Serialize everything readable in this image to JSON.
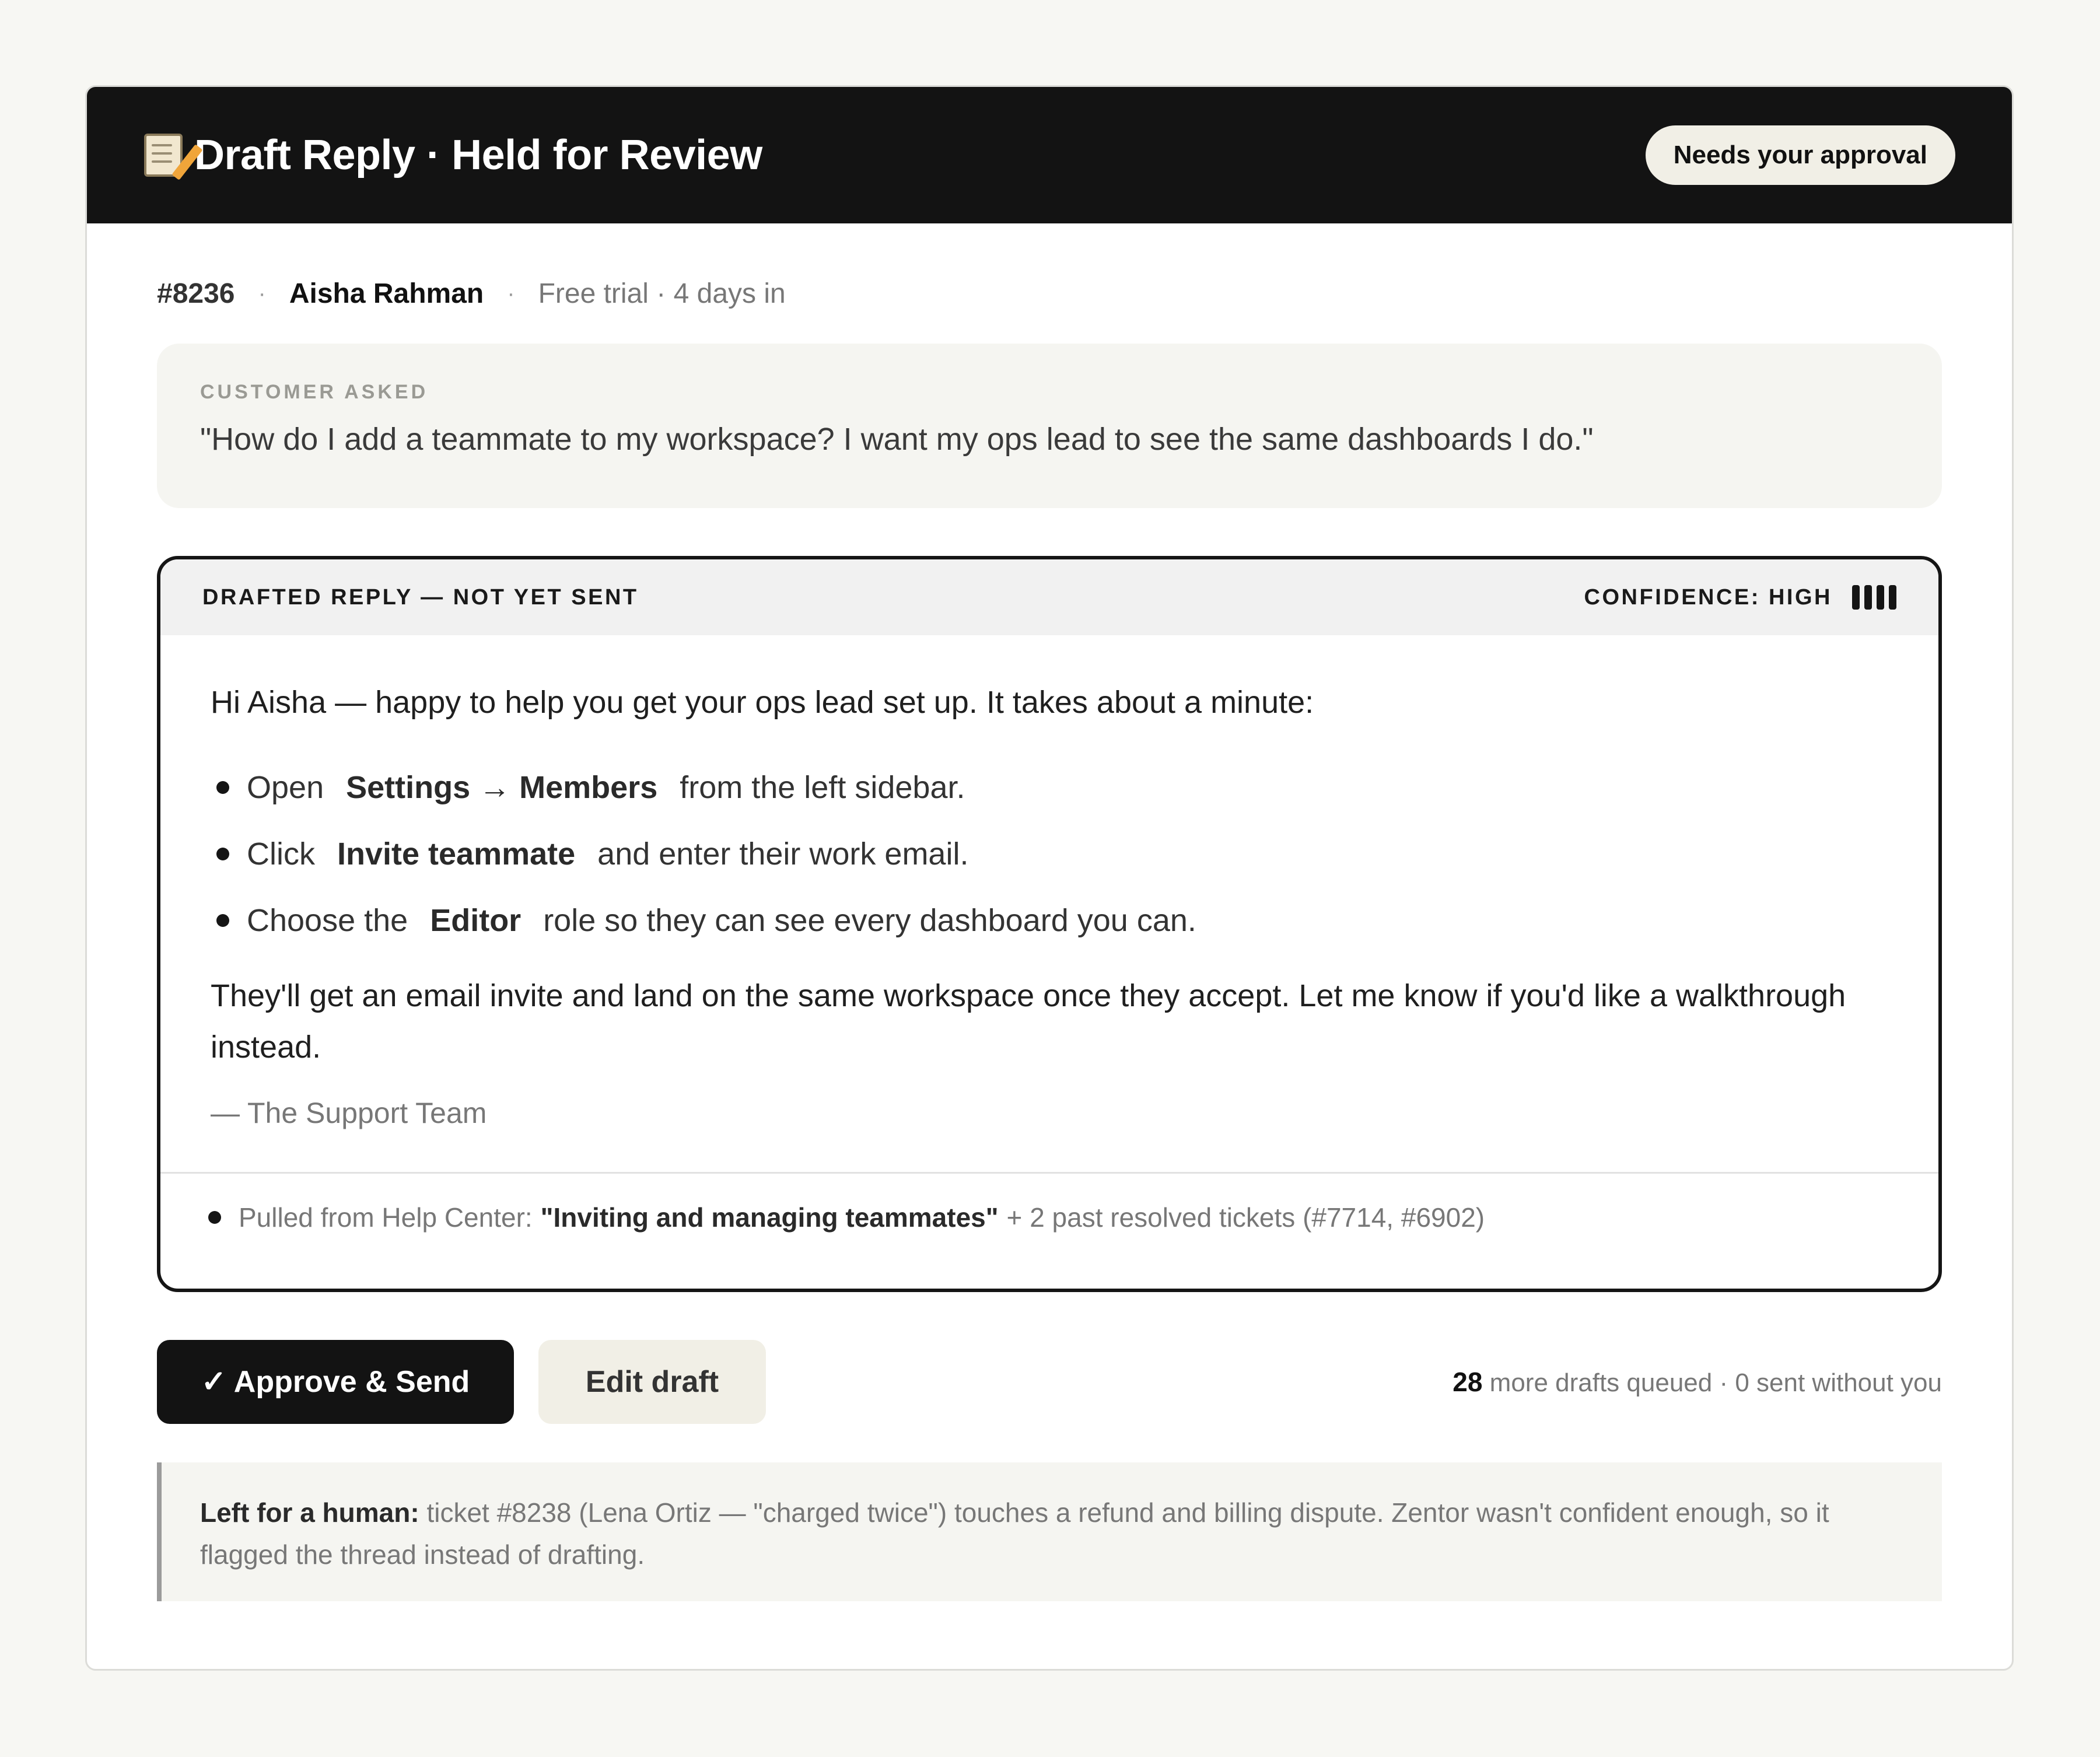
{
  "header": {
    "title": "Draft Reply · Held for Review",
    "status_pill": "Needs your approval"
  },
  "ticket": {
    "id": "#8236",
    "separator": "·",
    "customer_name": "Aisha Rahman",
    "plan": "Free trial · 4 days in"
  },
  "customer_question": {
    "label": "CUSTOMER ASKED",
    "text": "\"How do I add a teammate to my workspace? I want my ops lead to see the same dashboards I do.\""
  },
  "draft": {
    "label": "DRAFTED REPLY — NOT YET SENT",
    "confidence_label": "CONFIDENCE: HIGH",
    "confidence_level": 4,
    "greeting": "Hi Aisha — happy to help you get your ops lead set up. It takes about a minute:",
    "steps": [
      {
        "before": "Open",
        "bold": "Settings → Members",
        "after": "from the left sidebar."
      },
      {
        "before": "Click",
        "bold": "Invite teammate",
        "after": "and enter their work email."
      },
      {
        "before": "Choose the",
        "bold": "Editor",
        "after": "role so they can see every dashboard you can."
      }
    ],
    "outro": "They'll get an email invite and land on the same workspace once they accept. Let me know if you'd like a walkthrough instead.",
    "signature": "— The Support Team",
    "source": {
      "prefix": "Pulled from Help Center:",
      "article": "\"Inviting and managing teammates\"",
      "suffix": "+ 2 past resolved tickets (#7714, #6902)"
    }
  },
  "actions": {
    "approve_label": "✓ Approve & Send",
    "edit_label": "Edit draft",
    "queue_count": "28",
    "queue_text": "more drafts queued · 0 sent without you"
  },
  "handoff": {
    "label": "Left for a human:",
    "text": "ticket #8238 (Lena Ortiz — \"charged twice\") touches a refund and billing dispute. Zentor wasn't confident enough, so it flagged the thread instead of drafting."
  }
}
